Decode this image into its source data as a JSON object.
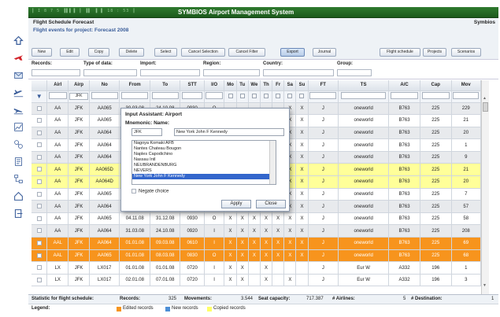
{
  "app": {
    "title": "SYMBIOS Airport Management System",
    "deco_text": "║ I 8 7 5   ▐▌▌▐ ║ ▐▌ ▐  ▌ 18 : 53 ║",
    "page_title": "Flight Schedule Forecast",
    "brand": "Symbios",
    "subtitle": "Flight events for project: Forecast 2008"
  },
  "toolbar": {
    "buttons": [
      "New",
      "Edit",
      "Copy",
      "Delete",
      "Select",
      "Cancel Selection",
      "Cancel Filter",
      "Export",
      "Journal"
    ],
    "right_buttons": [
      "Flight schedule",
      "Projects",
      "Scenarios"
    ]
  },
  "filters": {
    "labels": [
      "Records:",
      "Type of data:",
      "Import:",
      "Region:",
      "Country:",
      "Group:"
    ]
  },
  "table": {
    "columns": [
      "",
      "Airl",
      "Airp",
      "No",
      "From",
      "To",
      "STT",
      "I/O",
      "Mo",
      "Tu",
      "We",
      "Th",
      "Fr",
      "Sa",
      "Su",
      "FT",
      "TS",
      "A/C",
      "Cap",
      "Mov"
    ],
    "filter_airp": "JFK",
    "rows": [
      {
        "style": "gray",
        "cells": [
          "AA",
          "JFK",
          "AA065",
          "30.03.08",
          "24.10.08",
          "0930",
          "O",
          "",
          "",
          "",
          "",
          "",
          "X",
          "X",
          "J",
          "oneworld",
          "B763",
          "225",
          "229"
        ]
      },
      {
        "style": "white",
        "cells": [
          "AA",
          "JFK",
          "AA065",
          "05.07.08",
          "31.12.08",
          "0930",
          "O",
          "",
          "",
          "",
          "",
          "",
          "X",
          "X",
          "J",
          "oneworld",
          "B763",
          "225",
          "21"
        ]
      },
      {
        "style": "gray",
        "cells": [
          "AA",
          "JFK",
          "AA064",
          "10.03.08",
          "24.10.08",
          "0920",
          "I",
          "",
          "",
          "",
          "",
          "",
          "X",
          "X",
          "J",
          "oneworld",
          "B763",
          "225",
          "20"
        ]
      },
      {
        "style": "white",
        "cells": [
          "AA",
          "JFK",
          "AA064",
          "30.03.08",
          "24.10.08",
          "0920",
          "I",
          "",
          "",
          "",
          "",
          "",
          "X",
          "X",
          "J",
          "oneworld",
          "B763",
          "225",
          "1"
        ]
      },
      {
        "style": "gray",
        "cells": [
          "AA",
          "JFK",
          "AA064",
          "28.10.08",
          "31.12.08",
          "0920",
          "I",
          "",
          "",
          "",
          "",
          "",
          "X",
          "X",
          "J",
          "oneworld",
          "B763",
          "225",
          "9"
        ]
      },
      {
        "style": "yellow",
        "cells": [
          "AA",
          "JFK",
          "AA065D",
          "06.08.08",
          "24.10.08",
          "0930",
          "O",
          "",
          "",
          "",
          "",
          "",
          "X",
          "X",
          "J",
          "oneworld",
          "B763",
          "225",
          "21"
        ]
      },
      {
        "style": "yellow",
        "cells": [
          "AA",
          "JFK",
          "AA064D",
          "10.03.08",
          "24.10.08",
          "0920",
          "I",
          "",
          "",
          "",
          "",
          "",
          "X",
          "X",
          "J",
          "oneworld",
          "B763",
          "225",
          "20"
        ]
      },
      {
        "style": "white",
        "cells": [
          "AA",
          "JFK",
          "AA065",
          "28.10.08",
          "31.12.08",
          "0930",
          "O",
          "",
          "",
          "",
          "",
          "",
          "X",
          "X",
          "J",
          "oneworld",
          "B763",
          "225",
          "7"
        ]
      },
      {
        "style": "gray",
        "cells": [
          "AA",
          "JFK",
          "AA064",
          "05.11.08",
          "31.12.08",
          "0920",
          "I",
          "",
          "",
          "",
          "",
          "",
          "X",
          "X",
          "J",
          "oneworld",
          "B763",
          "225",
          "57"
        ]
      },
      {
        "style": "white",
        "cells": [
          "AA",
          "JFK",
          "AA065",
          "04.11.08",
          "31.12.08",
          "0930",
          "O",
          "X",
          "X",
          "X",
          "X",
          "X",
          "X",
          "X",
          "J",
          "oneworld",
          "B763",
          "225",
          "58"
        ]
      },
      {
        "style": "gray",
        "cells": [
          "AA",
          "JFK",
          "AA064",
          "31.03.08",
          "24.10.08",
          "0920",
          "I",
          "X",
          "X",
          "X",
          "X",
          "X",
          "X",
          "X",
          "J",
          "oneworld",
          "B763",
          "225",
          "208"
        ]
      },
      {
        "style": "orange",
        "cells": [
          "AAL",
          "JFK",
          "AA064",
          "01.01.08",
          "09.03.08",
          "0610",
          "I",
          "X",
          "X",
          "X",
          "X",
          "X",
          "X",
          "X",
          "J",
          "oneworld",
          "B763",
          "225",
          "69"
        ]
      },
      {
        "style": "orange",
        "cells": [
          "AAL",
          "JFK",
          "AA065",
          "01.01.08",
          "08.03.08",
          "0830",
          "O",
          "X",
          "X",
          "X",
          "X",
          "X",
          "X",
          "X",
          "J",
          "oneworld",
          "B763",
          "225",
          "68"
        ]
      },
      {
        "style": "white",
        "cells": [
          "LX",
          "JFK",
          "LX017",
          "01.01.08",
          "01.01.08",
          "0720",
          "I",
          "X",
          "X",
          "",
          "X",
          "",
          "",
          "",
          "J",
          "Eur W",
          "A332",
          "196",
          "1"
        ]
      },
      {
        "style": "white",
        "cells": [
          "LX",
          "JFK",
          "LX017",
          "02.01.08",
          "07.01.08",
          "0720",
          "I",
          "X",
          "X",
          "",
          "X",
          "",
          "X",
          "",
          "J",
          "Eur W",
          "A332",
          "196",
          "3"
        ]
      }
    ]
  },
  "status": {
    "label": "Statistic for flight schedule:",
    "records_label": "Records:",
    "records_value": "325",
    "movements_label": "Movements:",
    "movements_value": "3.544",
    "seat_label": "Seat capacity:",
    "seat_value": "717.387",
    "airlines_label": "# Airlines:",
    "airlines_value": "5",
    "dest_label": "# Destination:",
    "dest_value": "1"
  },
  "legend": {
    "label": "Legend:",
    "items": [
      {
        "text": "Edited records",
        "color": "#f7941d"
      },
      {
        "text": "New records",
        "color": "#4d8fd6"
      },
      {
        "text": "Copied records",
        "color": "#ffff66"
      }
    ]
  },
  "dialog": {
    "title": "Input Assistant: Airport",
    "mnemonic_label": "Mnemonic: Name:",
    "code_value": "JFK",
    "name_value": "New York John F Kennedy",
    "list": [
      "Nagoya Komaki AFB",
      "Nantes Chateau Bougon",
      "Naples Capodichino",
      "Nassau Intl",
      "NEUBRANDENBURG",
      "NEVERS",
      "New York John F Kennedy"
    ],
    "selected_index": 6,
    "negate_label": "Negate choice",
    "apply_label": "Apply",
    "close_label": "Close"
  }
}
